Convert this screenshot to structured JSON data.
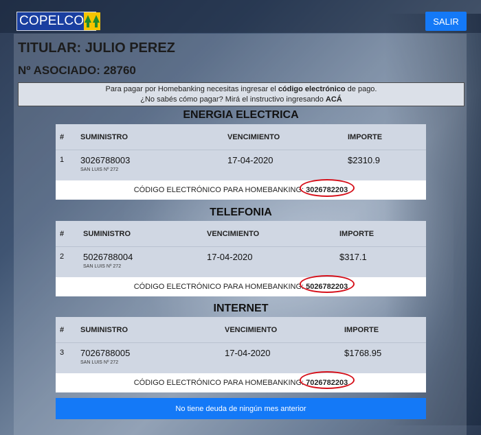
{
  "header": {
    "logo_text": "COPELCO",
    "logout_label": "SALIR"
  },
  "account": {
    "holder_label": "TITULAR:",
    "holder_name": "JULIO PEREZ",
    "member_label": "Nº ASOCIADO:",
    "member_number": "28760"
  },
  "info": {
    "line1_pre": "Para pagar por Homebanking necesitas ingresar el ",
    "line1_bold": "código electrónico",
    "line1_post": " de pago.",
    "line2_pre": "¿No sabés cómo pagar? Mirá el instructivo ingresando ",
    "line2_link": "ACÁ"
  },
  "table_headers": {
    "num": "#",
    "supply": "SUMINISTRO",
    "due": "VENCIMIENTO",
    "amount": "IMPORTE"
  },
  "code_label": "CÓDIGO ELECTRÓNICO PARA HOMEBANKING:",
  "services": [
    {
      "title": "ENERGIA ELECTRICA",
      "num": "1",
      "supply": "3026788003",
      "address": "SAN LUIS Nº 272",
      "due": "17-04-2020",
      "amount": "$2310.9",
      "code": "3026782203"
    },
    {
      "title": "TELEFONIA",
      "num": "2",
      "supply": "5026788004",
      "address": "SAN LUIS Nº 272",
      "due": "17-04-2020",
      "amount": "$317.1",
      "code": "5026782203"
    },
    {
      "title": "INTERNET",
      "num": "3",
      "supply": "7026788005",
      "address": "SAN LUIS Nº 272",
      "due": "17-04-2020",
      "amount": "$1768.95",
      "code": "7026782203"
    }
  ],
  "debt_notice": "No tiene deuda de ningún mes anterior",
  "colors": {
    "brand_blue": "#1a3fa0",
    "action_blue": "#1479f7",
    "highlight_red": "#d6101a",
    "logo_yellow": "#f5c400"
  }
}
